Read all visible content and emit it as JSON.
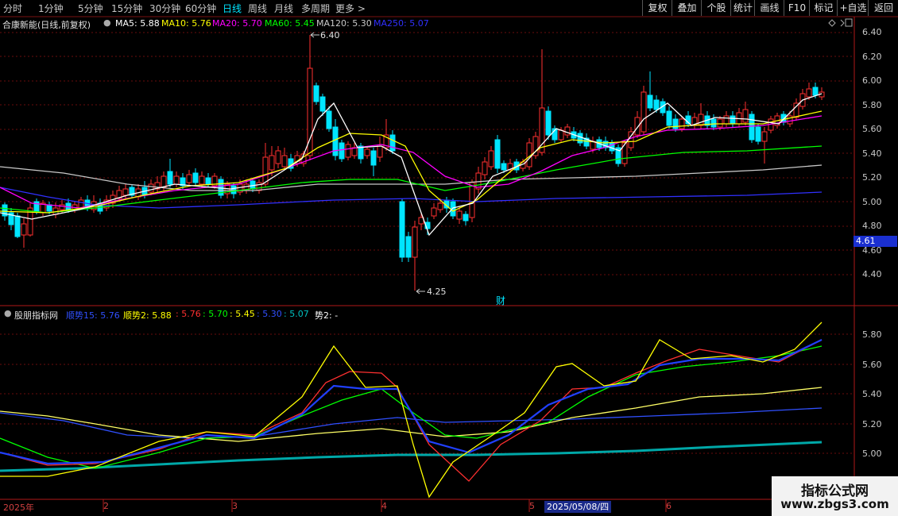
{
  "toolbar": {
    "tabs": [
      "分时",
      "1分钟",
      "5分钟",
      "15分钟",
      "30分钟",
      "60分钟",
      "日线",
      "周线",
      "月线",
      "多周期",
      "更多 >"
    ],
    "active": "日线",
    "right_buttons": [
      "复权",
      "叠加",
      "个股",
      "统计",
      "画线",
      "F10",
      "标记",
      "+自选",
      "返回"
    ]
  },
  "main_header": {
    "stock": "合康新能(日线,前复权)",
    "ma": [
      {
        "label": "MA5: 5.88",
        "color": "#ffffff"
      },
      {
        "label": "MA10: 5.76",
        "color": "#ffff00"
      },
      {
        "label": "MA20: 5.70",
        "color": "#ff00ff"
      },
      {
        "label": "MA60: 5.45",
        "color": "#00ff00"
      },
      {
        "label": "MA120: 5.30",
        "color": "#c8c8c8"
      },
      {
        "label": "MA250: 5.07",
        "color": "#3030ff"
      }
    ]
  },
  "price_axis": [
    "6.40",
    "6.20",
    "6.00",
    "5.80",
    "5.60",
    "5.40",
    "5.20",
    "5.00",
    "4.80",
    "4.60",
    "4.40"
  ],
  "indicator_axis": [
    "5.80",
    "5.60",
    "5.40",
    "5.20",
    "5.00"
  ],
  "annotations": {
    "high": "6.40",
    "low": "4.25",
    "finance": "财",
    "current_price": "4.61"
  },
  "indicator_header": {
    "name": "股朋指标网",
    "items": [
      {
        "label": "顺势15: 5.76",
        "color": "#3050ff"
      },
      {
        "label": "顺势2: 5.88",
        "color": "#ffff00"
      },
      {
        "label": ": 5.76",
        "color": "#ff3030"
      },
      {
        "label": ": 5.70",
        "color": "#00ff00"
      },
      {
        "label": ": 5.45",
        "color": "#ffff00"
      },
      {
        "label": ": 5.30",
        "color": "#3050ff"
      },
      {
        "label": ": 5.07",
        "color": "#00c0c0"
      },
      {
        "label": "势2: -",
        "color": "#ffffff"
      }
    ]
  },
  "date_axis": {
    "labels": [
      "2025年",
      "2",
      "3",
      "4",
      "5",
      "6"
    ],
    "highlight": "2025/05/08/四"
  },
  "watermark": {
    "line1": "指标公式网",
    "line2": "www.zbgs3.com"
  },
  "colors": {
    "up": "#ff3030",
    "down": "#00e5ff",
    "grid": "#7a1010"
  }
}
